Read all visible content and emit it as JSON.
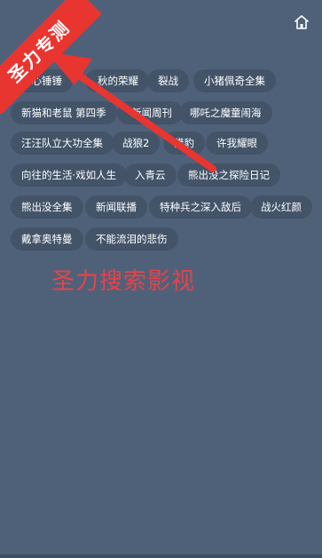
{
  "header": {
    "title": "",
    "home_icon": "home-icon"
  },
  "tags": [
    "开心锤锤",
    "秋的荣耀",
    "裂战",
    "小猪佩奇全集",
    "新猫和老鼠 第四季",
    "新闻周刊",
    "哪吒之魔童闹海",
    "汪汪队立大功全集",
    "战狼2",
    "猎豹",
    "许我耀眼",
    "向往的生活·戏如人生",
    "入青云",
    "熊出没之探险日记",
    "熊出没全集",
    "新闻联播",
    "特种兵之深入敌后",
    "战火红颜",
    "戴拿奥特曼",
    "不能流泪的悲伤"
  ],
  "promo": {
    "text": "圣力搜索影视",
    "color": "#e8424a"
  },
  "ribbon": {
    "text": "圣力专测",
    "color": "#e93530"
  },
  "colors": {
    "background": "#4e6179",
    "tag_background": "#435469",
    "text": "#ffffff"
  }
}
